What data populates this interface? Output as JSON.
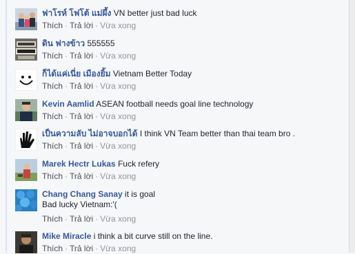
{
  "actions": {
    "like": "Thích",
    "reply": "Trả lời",
    "separator": "·"
  },
  "comments": [
    {
      "author": "ฟาโรห์ โฟโต้ แม่ผึ้ง",
      "text": "VN better just bad luck",
      "time": "Vừa xong",
      "avatar_icon": "family-photo-avatar"
    },
    {
      "author": "ดิน ฟางข้าว",
      "text": "555555",
      "time": "Vừa xong",
      "avatar_icon": "sign-photo-avatar"
    },
    {
      "author": "ก็ได้แค่เนี่ย เมืองยิ้ม",
      "text": "Vietnam Better Today",
      "time": "Vừa xong",
      "avatar_icon": "smiley-face-avatar"
    },
    {
      "author": "Kevin Aamlid",
      "text": "ASEAN football needs goal line technology",
      "time": "Vừa xong",
      "avatar_icon": "man-portrait-avatar"
    },
    {
      "author": "เป็นความลับ ไม่อาจบอกได้",
      "text": "I think VN Team better than thai team bro .",
      "time": "Vừa xong",
      "avatar_icon": "hand-drawing-avatar"
    },
    {
      "author": "Marek Hectr Lukas",
      "text": "Fuck refery",
      "time": "Vừa xong",
      "avatar_icon": "person-outdoor-avatar"
    },
    {
      "author": "Chang Chang Sanay",
      "text": "it is goal",
      "text2": "Bad lucky Vietnam:'(",
      "time": "Vừa xong",
      "avatar_icon": "blue-balls-avatar"
    },
    {
      "author": "Mike Miracle",
      "text": "i think a bit curve still on the line.",
      "time": "Vừa xong",
      "avatar_icon": "dark-portrait-avatar"
    }
  ],
  "colors": {
    "author": "#365899",
    "text": "#1d2129",
    "meta": "#90949c",
    "background": "#f6f7f9"
  }
}
